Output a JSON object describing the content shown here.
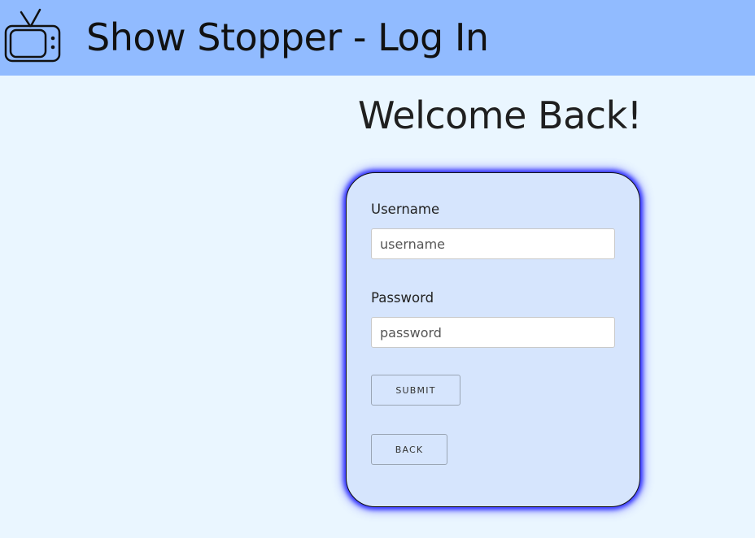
{
  "header": {
    "icon": "tv-icon",
    "title": "Show Stopper - Log In",
    "background": "#91bbff"
  },
  "main": {
    "heading": "Welcome Back!"
  },
  "login_form": {
    "username_label": "Username",
    "username_placeholder": "username",
    "username_value": "",
    "password_label": "Password",
    "password_placeholder": "password",
    "password_value": "",
    "submit_label": "SUBMIT",
    "back_label": "BACK",
    "card_background": "#d6e5fd",
    "glow_color": "#2b2bff"
  }
}
